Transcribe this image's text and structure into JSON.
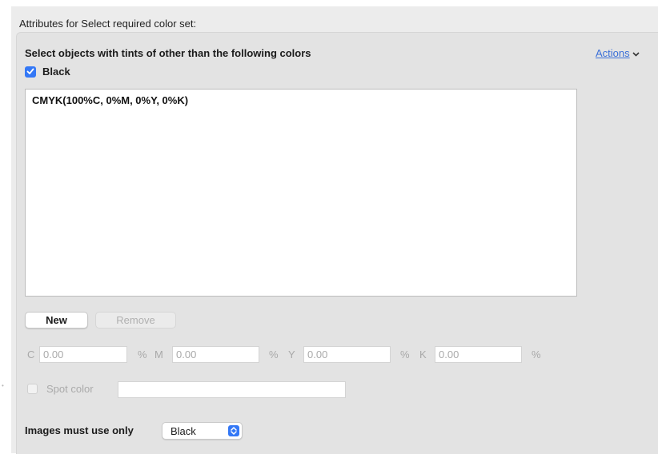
{
  "section_title": "Attributes for Select required color set:",
  "heading": "Select objects with tints of other than the following colors",
  "actions_label": "Actions",
  "black_checkbox": {
    "label": "Black",
    "checked": true
  },
  "color_list": [
    "CMYK(100%C, 0%M, 0%Y, 0%K)"
  ],
  "buttons": {
    "new": "New",
    "remove": "Remove"
  },
  "cmyk": {
    "c_label": "C",
    "c_value": "0.00",
    "c_unit": "%",
    "m_label": "M",
    "m_value": "0.00",
    "m_unit": "%",
    "y_label": "Y",
    "y_value": "0.00",
    "y_unit": "%",
    "k_label": "K",
    "k_value": "0.00",
    "k_unit": "%"
  },
  "spot_color": {
    "label": "Spot color",
    "checked": false,
    "value": ""
  },
  "images": {
    "label": "Images must use only",
    "selected": "Black"
  },
  "colors": {
    "accent": "#3478f6",
    "link": "#3a6fd8"
  }
}
